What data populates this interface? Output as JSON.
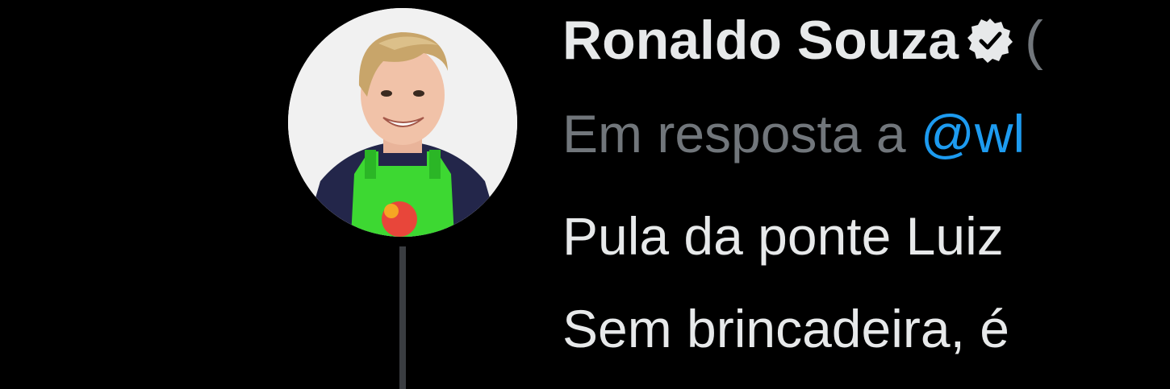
{
  "tweet": {
    "author": {
      "display_name": "Ronaldo Souza",
      "verified_icon": "verified-badge-icon",
      "handle_fragment": "(",
      "avatar_icon": "avatar-photo"
    },
    "reply": {
      "prefix": "Em resposta a ",
      "mention": "@wl"
    },
    "text_lines": [
      "Pula da ponte Luiz",
      "Sem brincadeira, é"
    ]
  },
  "colors": {
    "background": "#000000",
    "primary_text": "#e7e9ea",
    "secondary_text": "#71767b",
    "accent": "#1d9bf0",
    "thread_line": "#3a3d41"
  }
}
